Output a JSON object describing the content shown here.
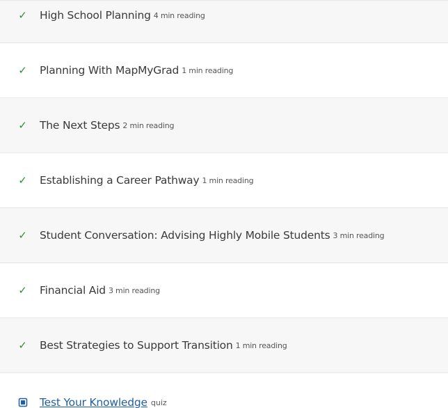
{
  "lessons": [
    {
      "check_icon": "checkmark-icon",
      "title": "High School Planning",
      "meta": "4 min reading"
    },
    {
      "check_icon": "checkmark-icon",
      "title": "Planning With MapMyGrad",
      "meta": "1 min reading"
    },
    {
      "check_icon": "checkmark-icon",
      "title": "The Next Steps",
      "meta": "2 min reading"
    },
    {
      "check_icon": "checkmark-icon",
      "title": "Establishing a Career Pathway",
      "meta": "1 min reading"
    },
    {
      "check_icon": "checkmark-icon",
      "title": "Student Conversation: Advising Highly Mobile Students",
      "meta": "3 min reading"
    },
    {
      "check_icon": "checkmark-icon",
      "title": "Financial Aid",
      "meta": "3 min reading"
    },
    {
      "check_icon": "checkmark-icon",
      "title": "Best Strategies to Support Transition",
      "meta": "1 min reading"
    }
  ],
  "quiz": {
    "icon": "quiz-icon",
    "title": "Test Your Knowledge",
    "meta": "quiz"
  },
  "colors": {
    "check": "#2f8f3a",
    "link": "#1f5fa6",
    "row_alt": "#f7f7f7",
    "row_white": "#ffffff",
    "divider": "#e6e6e6",
    "text": "#3a3a3a"
  }
}
